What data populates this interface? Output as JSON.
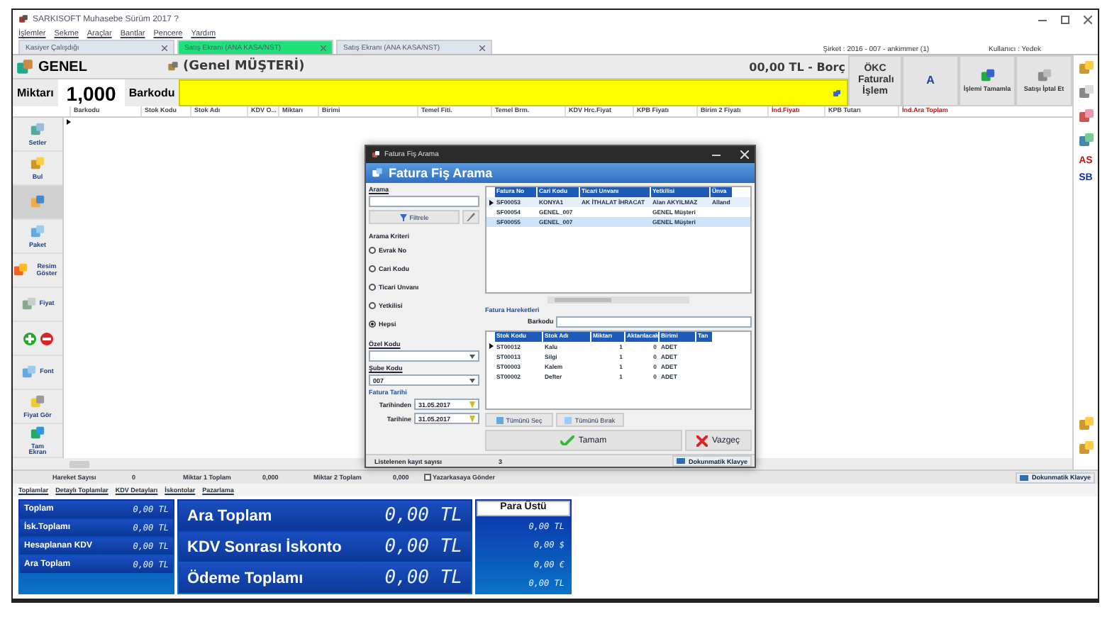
{
  "window": {
    "title": "SARKISOFT Muhasebe Sürüm 2017 ?"
  },
  "menu": [
    "İşlemler",
    "Sekme",
    "Araçlar",
    "Bantlar",
    "Pencere",
    "Yardım"
  ],
  "tabs": [
    {
      "label": "Kasiyer Çalışdığı",
      "selected": false
    },
    {
      "label": "Satış Ekranı (ANA KASA/NST)",
      "selected": true
    },
    {
      "label": "Satış Ekranı (ANA KASA/NST)",
      "selected": false
    }
  ],
  "company": "Şirket : 2016 - 007 - ankimmer (1)",
  "user": "Kullanıcı : Yedek",
  "customer": {
    "code": "GENEL",
    "name": "(Genel MÜŞTERİ)",
    "balance": "00,00 TL - Borç"
  },
  "quantity": {
    "label": "Miktarı",
    "value": "1,000"
  },
  "barcode": {
    "label": "Barkodu"
  },
  "action_buttons": [
    {
      "label": "ÖKC Faturalı İşlem",
      "kind": "big"
    },
    {
      "label": "A",
      "kind": "letter"
    },
    {
      "label": "İşlemi Tamamla",
      "kind": "icon"
    },
    {
      "label": "Satışı İptal Et",
      "kind": "icon"
    }
  ],
  "grid": {
    "columns": [
      {
        "label": "Barkodu",
        "highlight": false
      },
      {
        "label": "Stok Kodu",
        "highlight": false
      },
      {
        "label": "Stok Adı",
        "highlight": false
      },
      {
        "label": "KDV O...",
        "highlight": false
      },
      {
        "label": "Miktarı",
        "highlight": false
      },
      {
        "label": "Birimi",
        "highlight": false
      },
      {
        "label": "Temel Fiti.",
        "highlight": false
      },
      {
        "label": "Temel Brm.",
        "highlight": false
      },
      {
        "label": "KDV Hrc.Fiyat",
        "highlight": false
      },
      {
        "label": "KPB Fiyatı",
        "highlight": false
      },
      {
        "label": "Birim 2 Fiyatı",
        "highlight": false
      },
      {
        "label": "İnd.Fiyatı",
        "highlight": true
      },
      {
        "label": "KPB Tutarı",
        "highlight": false
      },
      {
        "label": "İnd.Ara Toplam",
        "highlight": true
      }
    ]
  },
  "left_tools": [
    {
      "label": "Setler",
      "kind": "stacked",
      "selected": false
    },
    {
      "label": "Bul",
      "kind": "stacked",
      "selected": false
    },
    {
      "kind": "stacked",
      "selected": true
    },
    {
      "label": "Paket",
      "kind": "stacked",
      "selected": false
    },
    {
      "label": "Resim Göster",
      "kind": "inline",
      "selected": false
    },
    {
      "label": "Fiyat",
      "kind": "inline",
      "selected": false
    },
    {
      "kind": "pair",
      "selected": false
    },
    {
      "label": "Font",
      "kind": "inline",
      "selected": false
    },
    {
      "label": "Fiyat Gör",
      "kind": "stacked",
      "selected": false
    },
    {
      "label": "Tam Ekran",
      "kind": "stacked",
      "selected": false
    }
  ],
  "right_tools": [
    {
      "kind": "icon"
    },
    {
      "kind": "icon"
    },
    {
      "kind": "icon"
    },
    {
      "kind": "icon"
    },
    {
      "kind": "text",
      "label": "AS",
      "color": "#d01010"
    },
    {
      "kind": "text",
      "label": "SB",
      "color": "#1030c0"
    }
  ],
  "right_tools_bottom": [
    {
      "kind": "icon"
    },
    {
      "kind": "icon"
    }
  ],
  "status": {
    "items": [
      {
        "label": "Hareket Sayısı",
        "value": "0"
      },
      {
        "label": "Miktar 1 Toplam",
        "value": "0,000"
      },
      {
        "label": "Miktar 2 Toplam",
        "value": "0,000"
      }
    ],
    "send_to_register": {
      "label": "Yazarkasaya Gönder",
      "checked": false
    },
    "keyboard": "Dokunmatik Klavye"
  },
  "total_tabs": [
    {
      "label": "Toplamlar",
      "selected": true
    },
    {
      "label": "Detaylı Toplamlar",
      "selected": false
    },
    {
      "label": "KDV Detayları",
      "selected": false
    },
    {
      "label": "İskontolar",
      "selected": false
    },
    {
      "label": "Pazarlama",
      "selected": false
    }
  ],
  "totals": {
    "small": [
      {
        "label": "Toplam",
        "value": "0,00 TL"
      },
      {
        "label": "İsk.Toplamı",
        "value": "0,00 TL"
      },
      {
        "label": "Hesaplanan KDV",
        "value": "0,00 TL"
      },
      {
        "label": "Ara Toplam",
        "value": "0,00 TL"
      }
    ],
    "large": [
      {
        "label": "Ara Toplam",
        "value": "0,00 TL"
      },
      {
        "label": "KDV Sonrası İskonto",
        "value": "0,00 TL"
      },
      {
        "label": "Ödeme Toplamı",
        "value": "0,00 TL"
      }
    ],
    "change": {
      "title": "Para Üstü",
      "values": [
        "0,00 TL",
        "0,00 $",
        "0,00 €",
        "0,00 TL"
      ]
    }
  },
  "dialog": {
    "title": "Fatura Fiş Arama",
    "header": "Fatura Fiş Arama",
    "search": {
      "label": "Arama"
    },
    "filter_button": "Filtrele",
    "criteria": {
      "title": "Arama Kriteri",
      "options": [
        {
          "label": "Evrak No",
          "selected": false
        },
        {
          "label": "Cari Kodu",
          "selected": false
        },
        {
          "label": "Ticari Unvanı",
          "selected": false
        },
        {
          "label": "Yetkilisi",
          "selected": false
        },
        {
          "label": "Hepsi",
          "selected": true
        }
      ]
    },
    "special_code": {
      "label": "Özel Kodu"
    },
    "branch_code": {
      "label": "Şube Kodu",
      "value": "007"
    },
    "date": {
      "title": "Fatura Tarihi",
      "from_label": "Tarihinden",
      "from": "31.05.2017",
      "to_label": "Tarihine",
      "to": "31.05.2017"
    },
    "invoices": {
      "columns": [
        "Fatura No",
        "Cari Kodu",
        "Ticari Unvanı",
        "Yetkilisi",
        "Ünva"
      ],
      "rows": [
        {
          "cells": [
            "SF00053",
            "KONYA1",
            "AK İTHALAT İHRACAT",
            "Alan AKYILMAZ",
            "Alland"
          ],
          "current": true,
          "selected": false
        },
        {
          "cells": [
            "SF00054",
            "GENEL_007",
            "",
            "GENEL Müşteri",
            ""
          ],
          "current": false,
          "selected": false
        },
        {
          "cells": [
            "SF00055",
            "GENEL_007",
            "",
            "GENEL Müşteri",
            ""
          ],
          "current": false,
          "selected": true
        }
      ]
    },
    "movements_title": "Fatura Hareketleri",
    "movements_barcode": "Barkodu",
    "movements": {
      "columns": [
        "Stok Kodu",
        "Stok Adı",
        "Miktarı",
        "Aktarılacak",
        "Birimi",
        "Tan"
      ],
      "rows": [
        {
          "cells": [
            "ST00012",
            "Kalu",
            "1",
            "0",
            "ADET",
            ""
          ],
          "current": true
        },
        {
          "cells": [
            "ST00013",
            "Silgi",
            "1",
            "0",
            "ADET",
            ""
          ],
          "current": false
        },
        {
          "cells": [
            "ST00003",
            "Kalem",
            "1",
            "0",
            "ADET",
            ""
          ],
          "current": false
        },
        {
          "cells": [
            "ST00002",
            "Defter",
            "1",
            "0",
            "ADET",
            ""
          ],
          "current": false
        }
      ]
    },
    "select_all": "Tümünü Seç",
    "deselect_all": "Tümünü Bırak",
    "ok": "Tamam",
    "cancel": "Vazgeç",
    "count_label": "Listelenen kayıt sayısı",
    "count": "3",
    "keyboard": "Dokunmatik Klavye"
  }
}
